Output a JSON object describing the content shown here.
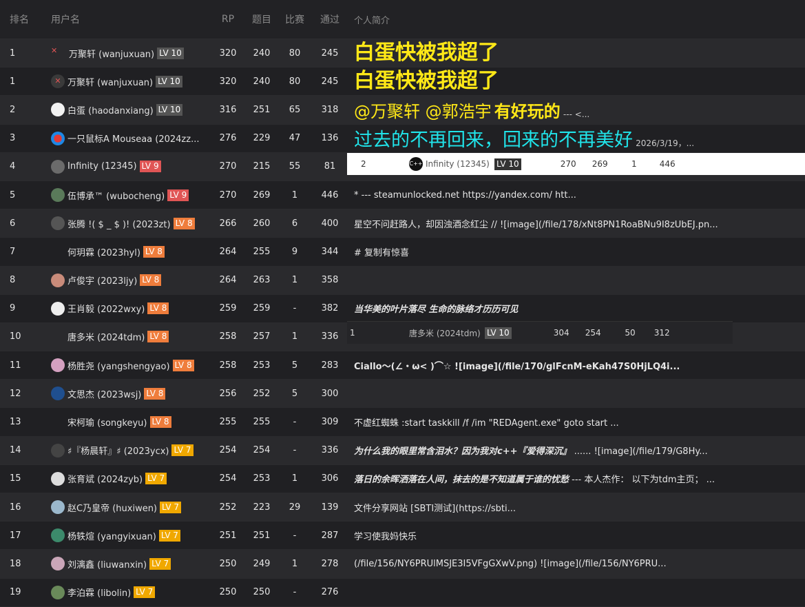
{
  "header": {
    "rank": "排名",
    "user": "用户名",
    "rp": "RP",
    "problems": "题目",
    "contests": "比赛",
    "passed": "通过",
    "bio": "个人简介"
  },
  "rows": [
    {
      "rank": "1",
      "user": "万聚轩 (wanjuxuan)",
      "lv": "LV 10",
      "rp": "320",
      "problems": "240",
      "contests": "80",
      "passed": "245",
      "bio": "白蛋快被我超了"
    },
    {
      "rank": "1",
      "user": "万聚轩 (wanjuxuan)",
      "lv": "LV 10",
      "rp": "320",
      "problems": "240",
      "contests": "80",
      "passed": "245",
      "bio": "白蛋快被我超了"
    },
    {
      "rank": "2",
      "user": "白蛋 (haodanxiang)",
      "lv": "LV 10",
      "rp": "316",
      "problems": "251",
      "contests": "65",
      "passed": "318",
      "bio": "@万聚轩 @郭浩宇",
      "bio_b": "有好玩的",
      "bio_c": "--- <..."
    },
    {
      "rank": "3",
      "user": "一只鼠标A Mouseaa (2024zz...",
      "lv": "",
      "rp": "276",
      "problems": "229",
      "contests": "47",
      "passed": "136",
      "bio": "过去的不再回来，回来的不再美好",
      "bio_b": "2026/3/19，..."
    },
    {
      "rank": "4",
      "user": "Infinity (12345)",
      "lv": "LV 9",
      "rp": "270",
      "problems": "215",
      "contests": "55",
      "passed": "81",
      "bio": ""
    },
    {
      "rank": "5",
      "user": "伍博承™ (wubocheng)",
      "lv": "LV 9",
      "rp": "270",
      "problems": "269",
      "contests": "1",
      "passed": "446",
      "bio": "* --- steamunlocked.net https://yandex.com/ htt..."
    },
    {
      "rank": "6",
      "user": "张腾 !( $ _ $ )! (2023zt)",
      "lv": "LV 8",
      "rp": "266",
      "problems": "260",
      "contests": "6",
      "passed": "400",
      "bio": "星空不问赶路人，却因浊酒念红尘 // ![image](/file/178/xNt8PN1RoaBNu9I8zUbEJ.pn..."
    },
    {
      "rank": "7",
      "user": "何玥霖 (2023hyl)",
      "lv": "LV 8",
      "rp": "264",
      "problems": "255",
      "contests": "9",
      "passed": "344",
      "bio": "# 复制有惊喜"
    },
    {
      "rank": "8",
      "user": "卢俊宇 (2023ljy)",
      "lv": "LV 8",
      "rp": "264",
      "problems": "263",
      "contests": "1",
      "passed": "358",
      "bio": ""
    },
    {
      "rank": "9",
      "user": "王肖毅 (2022wxy)",
      "lv": "LV 8",
      "rp": "259",
      "problems": "259",
      "contests": "-",
      "passed": "382",
      "bio": "当华美的叶片落尽 生命的脉络才历历可见"
    },
    {
      "rank": "10",
      "user": "唐多米 (2024tdm)",
      "lv": "LV 8",
      "rp": "258",
      "problems": "257",
      "contests": "1",
      "passed": "336",
      "bio": ""
    },
    {
      "rank": "11",
      "user": "杨胜尧 (yangshengyao)",
      "lv": "LV 8",
      "rp": "258",
      "problems": "253",
      "contests": "5",
      "passed": "283",
      "bio": "Ciallo～(∠・ω< )⌒☆ ![image](/file/170/glFcnM-eKah47S0HjLQ4i..."
    },
    {
      "rank": "12",
      "user": "文思杰 (2023wsj)",
      "lv": "LV 8",
      "rp": "256",
      "problems": "252",
      "contests": "5",
      "passed": "300",
      "bio": ""
    },
    {
      "rank": "13",
      "user": "宋柯瑜 (songkeyu)",
      "lv": "LV 8",
      "rp": "255",
      "problems": "255",
      "contests": "-",
      "passed": "309",
      "bio": "不虚红蜘蛛 :start taskkill /f /im \"REDAgent.exe\" goto start ..."
    },
    {
      "rank": "14",
      "user": "♯『杨晨轩』♯ (2023ycx)",
      "lv": "LV 7",
      "rp": "254",
      "problems": "254",
      "contests": "-",
      "passed": "336",
      "bio": "为什么我的眼里常含泪水？因为我对c++『爱得深沉』",
      "bio_b": "...... ![image](/file/179/G8Hy..."
    },
    {
      "rank": "15",
      "user": "张育斌 (2024zyb)",
      "lv": "LV 7",
      "rp": "254",
      "problems": "253",
      "contests": "1",
      "passed": "306",
      "bio": "落日的余晖洒落在人间，抹去的是不知道属于谁的忧愁",
      "bio_b": "--- 本人杰作： 以下为tdm主页； ..."
    },
    {
      "rank": "16",
      "user": "赵C乃皇帝 (huxiwen)",
      "lv": "LV 7",
      "rp": "252",
      "problems": "223",
      "contests": "29",
      "passed": "139",
      "bio": "文件分享网站 [SBTI测试](https://sbti..."
    },
    {
      "rank": "17",
      "user": "杨轶煊 (yangyixuan)",
      "lv": "LV 7",
      "rp": "251",
      "problems": "251",
      "contests": "-",
      "passed": "287",
      "bio": "学习使我妈快乐"
    },
    {
      "rank": "18",
      "user": "刘漓鑫 (liuwanxin)",
      "lv": "LV 7",
      "rp": "250",
      "problems": "249",
      "contests": "1",
      "passed": "278",
      "bio": "(/file/156/NY6PRUlMSJE3I5VFgGXwV.png) ![image](/file/156/NY6PRU..."
    },
    {
      "rank": "19",
      "user": "李泊霖 (libolin)",
      "lv": "LV 7",
      "rp": "250",
      "problems": "250",
      "contests": "-",
      "passed": "276",
      "bio": ""
    }
  ],
  "embed1": {
    "rank": "2",
    "user": "Infinity (12345)",
    "lv": "LV 10",
    "rp": "270",
    "problems": "269",
    "contests": "1",
    "passed": "446"
  },
  "embed2": {
    "rank": "1",
    "user": "唐多米 (2024tdm)",
    "lv": "LV 10",
    "rp": "304",
    "problems": "254",
    "contests": "50",
    "passed": "312"
  },
  "colors": {
    "bg": "#222225",
    "yellow": "#ffe817",
    "cyan": "#20e4ea",
    "lv10": "#555555",
    "lv9": "#e05555",
    "lv8": "#ef7d3c",
    "lv7": "#f0a800"
  }
}
